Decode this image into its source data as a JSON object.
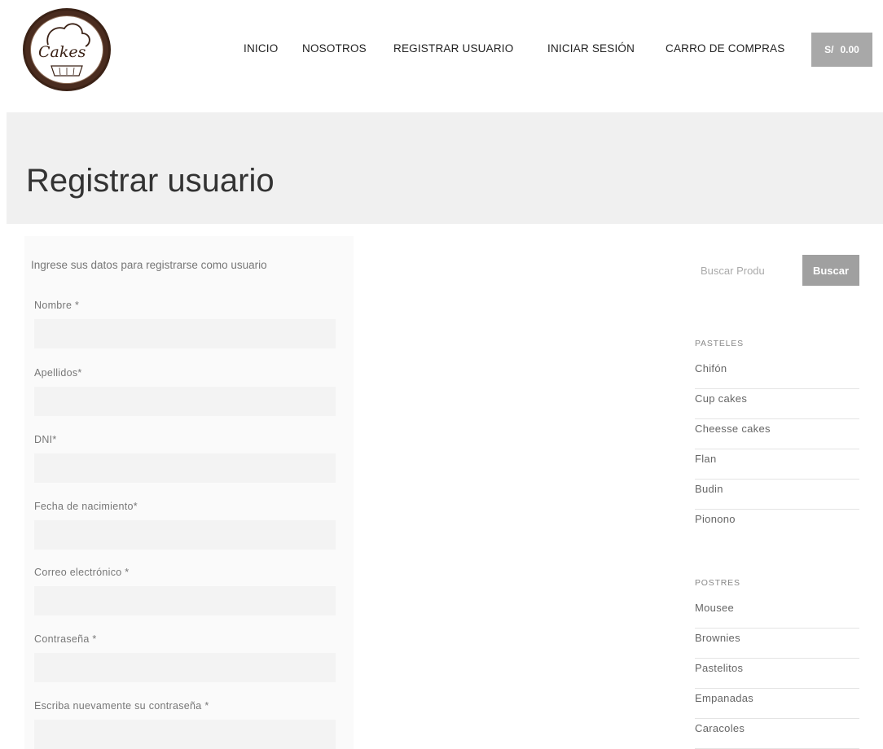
{
  "brand": {
    "logo_text": "Cakes"
  },
  "nav": {
    "items": [
      "INICIO",
      "NOSOTROS",
      "REGISTRAR USUARIO",
      "INICIAR SESIÓN",
      "CARRO DE COMPRAS"
    ],
    "cart_currency": "S/",
    "cart_total": "0.00"
  },
  "page": {
    "title": "Registrar usuario"
  },
  "form": {
    "intro": "Ingrese sus datos para registrarse como usuario",
    "fields": [
      {
        "label": "Nombre *",
        "value": ""
      },
      {
        "label": "Apellidos*",
        "value": ""
      },
      {
        "label": "DNI*",
        "value": ""
      },
      {
        "label": "Fecha de nacimiento*",
        "value": ""
      },
      {
        "label": "Correo electrónico *",
        "value": ""
      },
      {
        "label": "Contraseña *",
        "value": ""
      },
      {
        "label": "Escriba nuevamente su contraseña *",
        "value": ""
      }
    ]
  },
  "search": {
    "placeholder": "Buscar Produ",
    "button_label": "Buscar"
  },
  "categories": [
    {
      "heading": "PASTELES",
      "items": [
        "Chifón",
        "Cup cakes",
        "Cheesse cakes",
        "Flan",
        "Budin",
        "Pionono"
      ]
    },
    {
      "heading": "POSTRES",
      "items": [
        "Mousee",
        "Brownies",
        "Pastelitos",
        "Empanadas",
        "Caracoles"
      ]
    }
  ],
  "colors": {
    "cart_bg": "#a8a8a8",
    "search_btn_bg": "#a0a0a0",
    "banner_bg": "#f0f0f0",
    "logo_brown": "#4a2c1f"
  }
}
